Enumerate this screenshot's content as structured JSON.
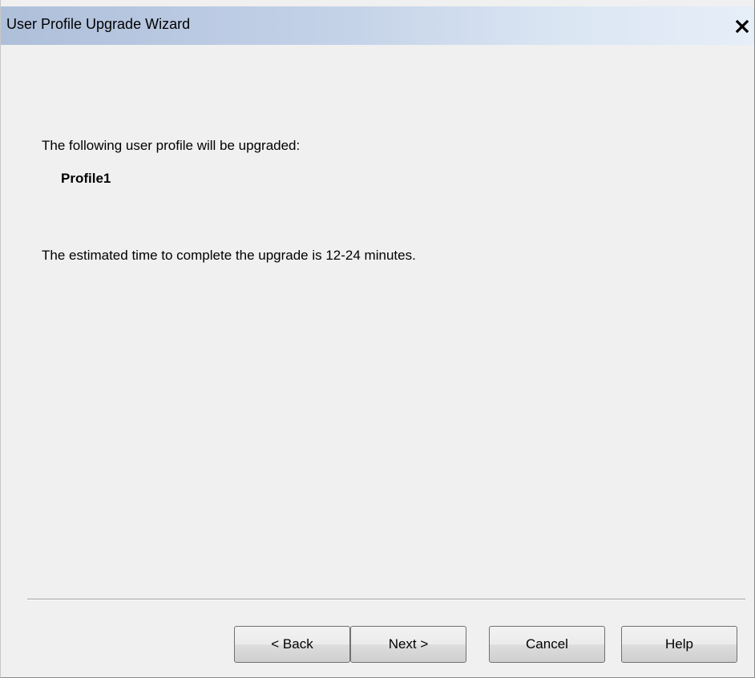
{
  "window": {
    "title": "User Profile Upgrade Wizard",
    "close_icon": "close-icon"
  },
  "main": {
    "intro_text": "The following user profile will be upgraded:",
    "profile_name": "Profile1",
    "estimate_text": "The estimated time to complete the upgrade is 12-24 minutes."
  },
  "buttons": {
    "back_label": "< Back",
    "next_label": "Next >",
    "cancel_label": "Cancel",
    "help_label": "Help"
  },
  "colors": {
    "titlebar_start": "#aebfda",
    "titlebar_end": "#e6eef8",
    "background": "#f0f0f0"
  }
}
